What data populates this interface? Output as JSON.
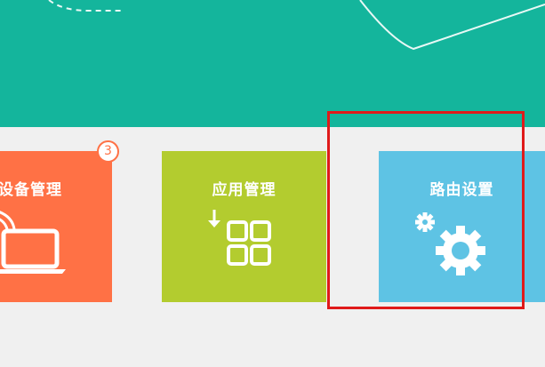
{
  "tiles": {
    "device": {
      "label": "设备管理",
      "badge": "3",
      "color": "#ff7145"
    },
    "apps": {
      "label": "应用管理",
      "color": "#b3cc2f"
    },
    "router": {
      "label": "路由设置",
      "color": "#5ec3e4"
    }
  },
  "banner": {
    "color": "#14b59c"
  },
  "highlight": {
    "color": "#e01a1a"
  }
}
